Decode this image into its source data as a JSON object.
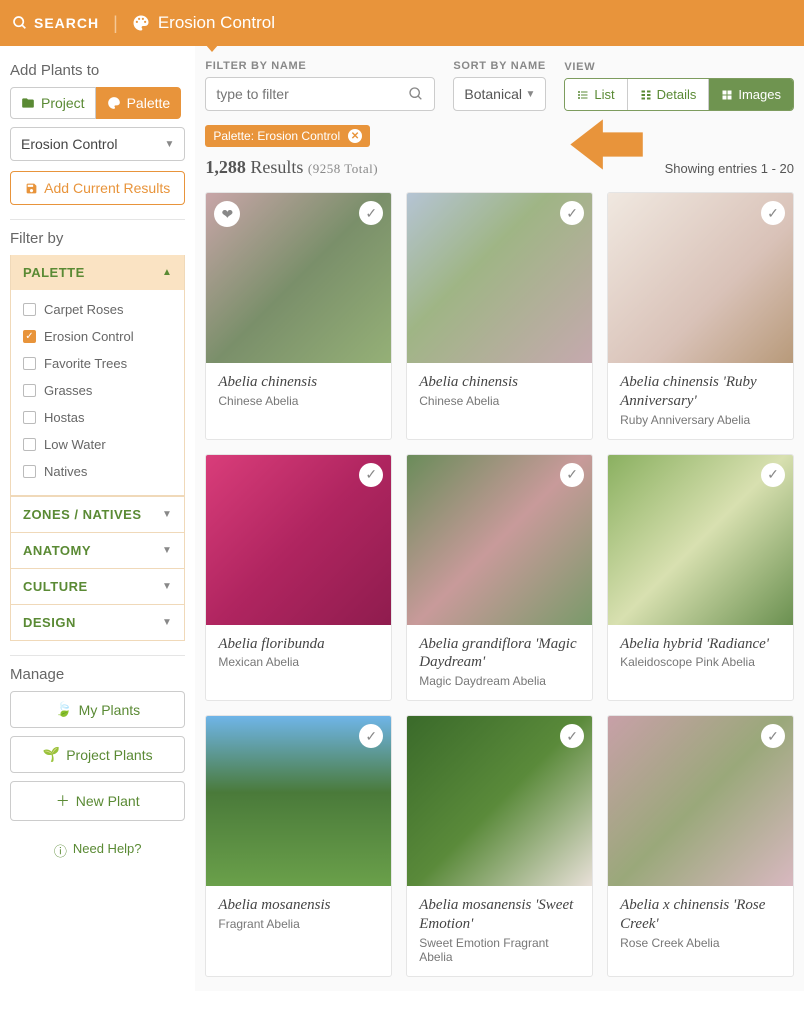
{
  "topbar": {
    "search_label": "SEARCH",
    "title": "Erosion Control"
  },
  "sidebar": {
    "add_plants_heading": "Add Plants to",
    "project_label": "Project",
    "palette_label": "Palette",
    "selected_palette": "Erosion Control",
    "add_results_label": "Add Current Results",
    "filter_by_heading": "Filter by",
    "palette_section": "PALETTE",
    "palette_items": [
      {
        "label": "Carpet Roses",
        "checked": false
      },
      {
        "label": "Erosion Control",
        "checked": true
      },
      {
        "label": "Favorite Trees",
        "checked": false
      },
      {
        "label": "Grasses",
        "checked": false
      },
      {
        "label": "Hostas",
        "checked": false
      },
      {
        "label": "Low Water",
        "checked": false
      },
      {
        "label": "Natives",
        "checked": false
      }
    ],
    "sections": [
      "ZONES / NATIVES",
      "ANATOMY",
      "CULTURE",
      "DESIGN"
    ],
    "manage_heading": "Manage",
    "manage_items": [
      "My Plants",
      "Project Plants",
      "New Plant"
    ],
    "help_label": "Need Help?"
  },
  "filters": {
    "filter_label": "FILTER BY NAME",
    "filter_placeholder": "type to filter",
    "sort_label": "SORT BY NAME",
    "sort_value": "Botanical",
    "view_label": "VIEW",
    "view_options": [
      "List",
      "Details",
      "Images"
    ],
    "chip_label": "Palette: Erosion Control"
  },
  "results": {
    "count": "1,288",
    "count_word": "Results",
    "total": "(9258 Total)",
    "showing": "Showing entries 1 - 20"
  },
  "plants": [
    {
      "name": "Abelia chinensis",
      "common": "Chinese Abelia",
      "bg": "linear-gradient(135deg,#c8a5a8 0%,#7a8f6a 50%,#95b077 100%)",
      "leaf": true
    },
    {
      "name": "Abelia chinensis",
      "common": "Chinese Abelia",
      "bg": "linear-gradient(135deg,#b5c4d4 0%,#9fb585 40%,#c5a9ae 100%)"
    },
    {
      "name": "Abelia chinensis 'Ruby Anniversary'",
      "common": "Ruby Anniversary Abelia",
      "bg": "linear-gradient(135deg,#f0e8e0 0%,#d9c2b8 60%,#b89a7a 100%)"
    },
    {
      "name": "Abelia floribunda",
      "common": "Mexican Abelia",
      "bg": "linear-gradient(135deg,#d93d7a 0%,#b02560 50%,#8f1c4e 100%)"
    },
    {
      "name": "Abelia grandiflora 'Magic Daydream'",
      "common": "Magic Daydream Abelia",
      "bg": "linear-gradient(135deg,#6a8c5a 0%,#c89a9a 50%,#7a9a6a 100%)"
    },
    {
      "name": "Abelia hybrid 'Radiance'",
      "common": "Kaleidoscope Pink Abelia",
      "bg": "linear-gradient(135deg,#8ab060 0%,#d8e0b0 50%,#6a9050 100%)"
    },
    {
      "name": "Abelia mosanensis",
      "common": "Fragrant Abelia",
      "bg": "linear-gradient(180deg,#6fb5e8 0%,#4a7a3a 45%,#6aa04a 100%)"
    },
    {
      "name": "Abelia mosanensis 'Sweet Emotion'",
      "common": "Sweet Emotion Fragrant Abelia",
      "bg": "linear-gradient(135deg,#3a6a2a 0%,#5a8a3a 50%,#e8e0d8 100%)"
    },
    {
      "name": "Abelia x chinensis 'Rose Creek'",
      "common": "Rose Creek Abelia",
      "bg": "linear-gradient(135deg,#c8a0a8 0%,#9aa87a 50%,#d8b8c0 100%)"
    }
  ]
}
